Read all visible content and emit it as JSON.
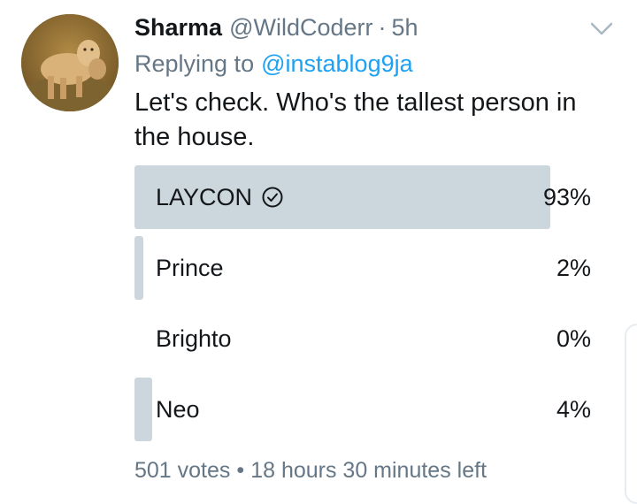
{
  "tweet": {
    "author_name": "Sharma",
    "author_handle": "@WildCoderr",
    "separator": "·",
    "time": "5h",
    "replying_prefix": "Replying to",
    "replying_to": "@instablog9ja",
    "text": "Let's check. Who's the tallest person in the house."
  },
  "poll": {
    "options": [
      {
        "label": "LAYCON",
        "percent_label": "93%",
        "percent": 93,
        "winner": true
      },
      {
        "label": "Prince",
        "percent_label": "2%",
        "percent": 2,
        "winner": false
      },
      {
        "label": "Brighto",
        "percent_label": "0%",
        "percent": 0,
        "winner": false
      },
      {
        "label": "Neo",
        "percent_label": "4%",
        "percent": 4,
        "winner": false
      }
    ],
    "votes": "501 votes",
    "footer_separator": "•",
    "time_left": "18 hours 30 minutes left"
  },
  "icons": {
    "menu": "chevron-down-icon",
    "winner": "check-circle-icon",
    "avatar": "lioness-photo"
  },
  "colors": {
    "bar": "#ccd6dd",
    "link": "#1da1f2",
    "secondary_text": "#657786",
    "primary_text": "#14171a"
  }
}
